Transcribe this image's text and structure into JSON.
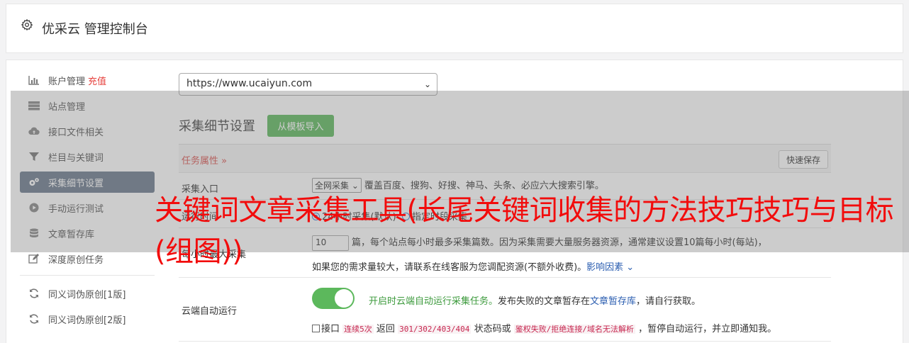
{
  "header": {
    "title": "优采云 管理控制台"
  },
  "sidebar": {
    "items": [
      {
        "label": "账户管理",
        "extra": "充值",
        "icon": "bar-chart-icon"
      },
      {
        "label": "站点管理",
        "icon": "server-icon"
      },
      {
        "label": "接口文件相关",
        "icon": "cloud-upload-icon"
      },
      {
        "label": "栏目与关键词",
        "icon": "filter-icon"
      },
      {
        "label": "采集细节设置",
        "icon": "gears-icon",
        "active": true
      },
      {
        "label": "手动运行测试",
        "icon": "play-circle-icon"
      },
      {
        "label": "文章暂存库",
        "icon": "database-icon"
      },
      {
        "label": "深度原创任务",
        "icon": "edit-icon"
      },
      {
        "label": "同义词伪原创[1版]",
        "icon": "refresh-icon"
      },
      {
        "label": "同义词伪原创[2版]",
        "icon": "refresh-icon"
      }
    ]
  },
  "site_select": {
    "value": "https://www.ucaiyun.com"
  },
  "section": {
    "title": "采集细节设置",
    "template_button": "从模板导入"
  },
  "table": {
    "task_attr": "任务属性 »",
    "save_button": "快速保存",
    "entry": {
      "label": "采集入口",
      "select": "全网采集",
      "desc": "覆盖百度、搜狗、好搜、神马、头条、必应六大搜索引擎。"
    },
    "run_time": {
      "label": "运行时间",
      "opt1": "24小时采集(默认)",
      "opt2": "指定时段采集"
    },
    "per_hour": {
      "label": "每小时最大采集",
      "input": "10",
      "text1": "篇，每个站点每小时最多采集篇数。因为采集需要大量服务器资源，通常建议设置10篇每小时(每站)，",
      "text2": "如果您的需求量较大，请联系在线客服为您调配资源(不额外收费)。",
      "link": "影响因素"
    },
    "cloud": {
      "label": "云端自动运行",
      "on_text": "开启时云端自动运行采集任务。",
      "fail_text": "发布失败的文章暂存在",
      "fail_link": "文章暂存库",
      "fail_tail": "，请自行获取。",
      "chk_label": "接口",
      "code1": "连续5次",
      "mid1": "返回",
      "code2": "301/302/403/404",
      "mid2": "状态码或",
      "code3": "鉴权失败/拒绝连接/域名无法解析",
      "tail": "，暂停自动运行，并立即通知我。"
    }
  },
  "overlay": {
    "headline": "关键词文章采集工具(长尾关键词收集的方法技巧技巧与目标(组图))"
  }
}
